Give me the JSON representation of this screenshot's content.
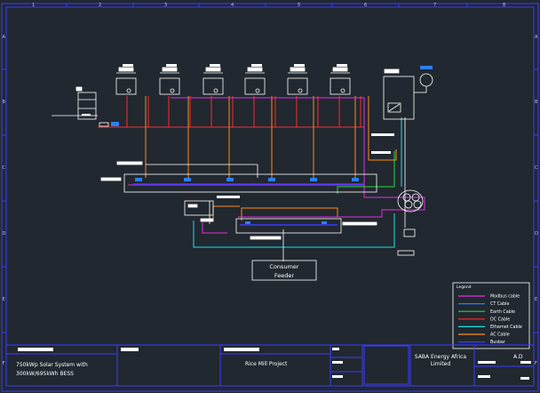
{
  "grid": {
    "columns": [
      "1",
      "2",
      "3",
      "4",
      "5",
      "6",
      "7",
      "8"
    ],
    "rows": [
      "A",
      "B",
      "C",
      "D",
      "E",
      "F"
    ]
  },
  "feeder": {
    "line1": "Consumer",
    "line2": "Feeder"
  },
  "legend": {
    "title": "Legend",
    "items": [
      {
        "label": "Modbus cable",
        "color": "#e030e0"
      },
      {
        "label": "CT Cable",
        "color": "#2a7fff"
      },
      {
        "label": "Earth Cable",
        "color": "#22d83a"
      },
      {
        "label": "DC Cable",
        "color": "#ff2a2a"
      },
      {
        "label": "Ethernet Cable",
        "color": "#20e0e0"
      },
      {
        "label": "AC Cable",
        "color": "#ff8a1a"
      },
      {
        "label": "Busbar",
        "color": "#3a3aff"
      }
    ]
  },
  "title_block": {
    "system_line1": "750kWp Solar System with",
    "system_line2": "300kW/695kWh BESS",
    "project": "Rice Mill Project",
    "company_line1": "SABA Energy Africa",
    "company_line2": "Limited",
    "initials": "A.D"
  },
  "colors": {
    "background": "#212830",
    "frame": "#3b3bff",
    "dc_cable": "#ff2a2a",
    "ac_cable": "#ff8a1a",
    "modbus_cable": "#e030e0",
    "earth_cable": "#22d83a",
    "ethernet_cable": "#20e0e0",
    "busbar": "#3a3aff",
    "equipment": "#ffffff",
    "ct_marker": "#2a7fff"
  }
}
